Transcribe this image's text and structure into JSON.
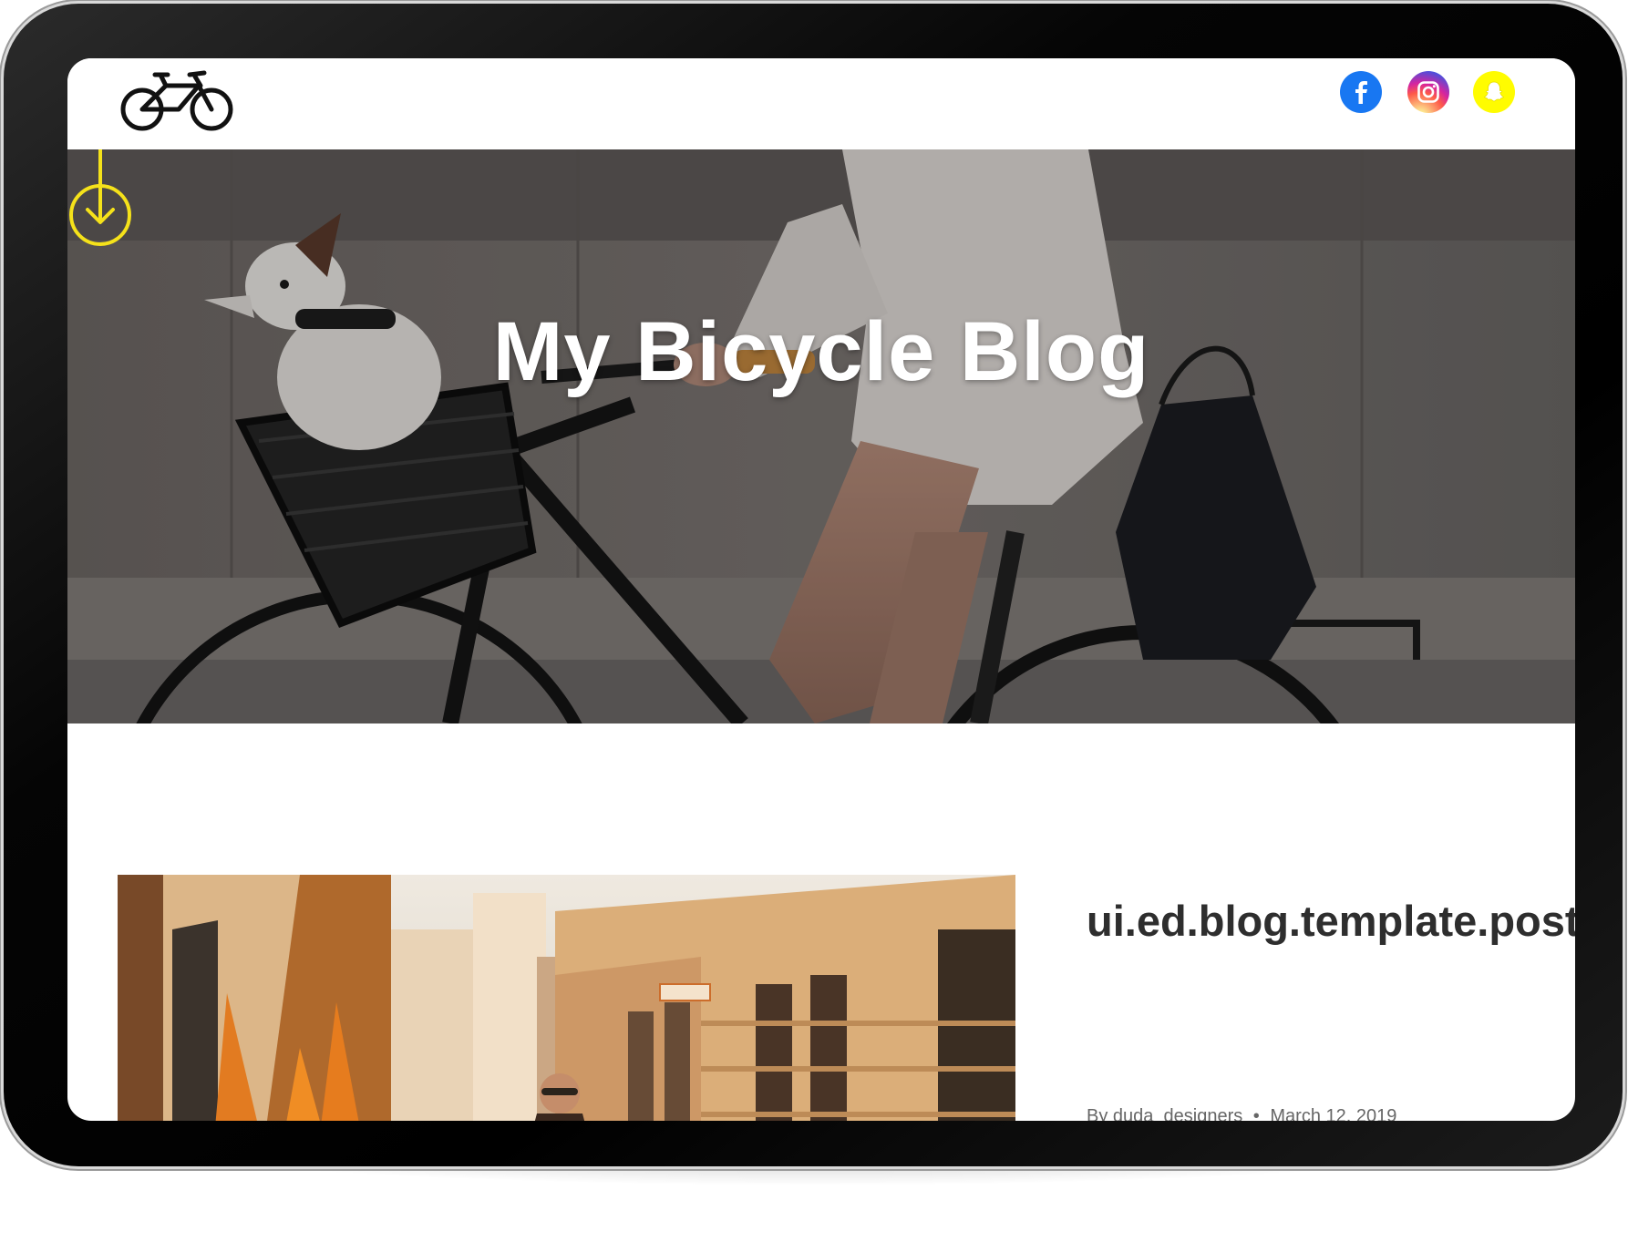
{
  "hero": {
    "title": "My Bicycle Blog"
  },
  "header": {
    "logo_icon": "bicycle-icon",
    "social": [
      {
        "name": "facebook-icon",
        "color": "#1877f2"
      },
      {
        "name": "instagram-icon",
        "color": "#d6249f"
      },
      {
        "name": "snapchat-icon",
        "color": "#fffc00"
      }
    ]
  },
  "scroll_indicator": {
    "icon": "arrow-down-circle-icon",
    "color": "#f5e21a"
  },
  "post": {
    "title": "ui.ed.blog.template.post.title.myFavoritePaths",
    "author": "By duda_designers",
    "separator": "•",
    "date": "March 12, 2019"
  },
  "colors": {
    "device_frame": "#000000",
    "page_background": "#ffffff",
    "title_text": "#ffffff",
    "post_title": "#2e2e2e"
  }
}
